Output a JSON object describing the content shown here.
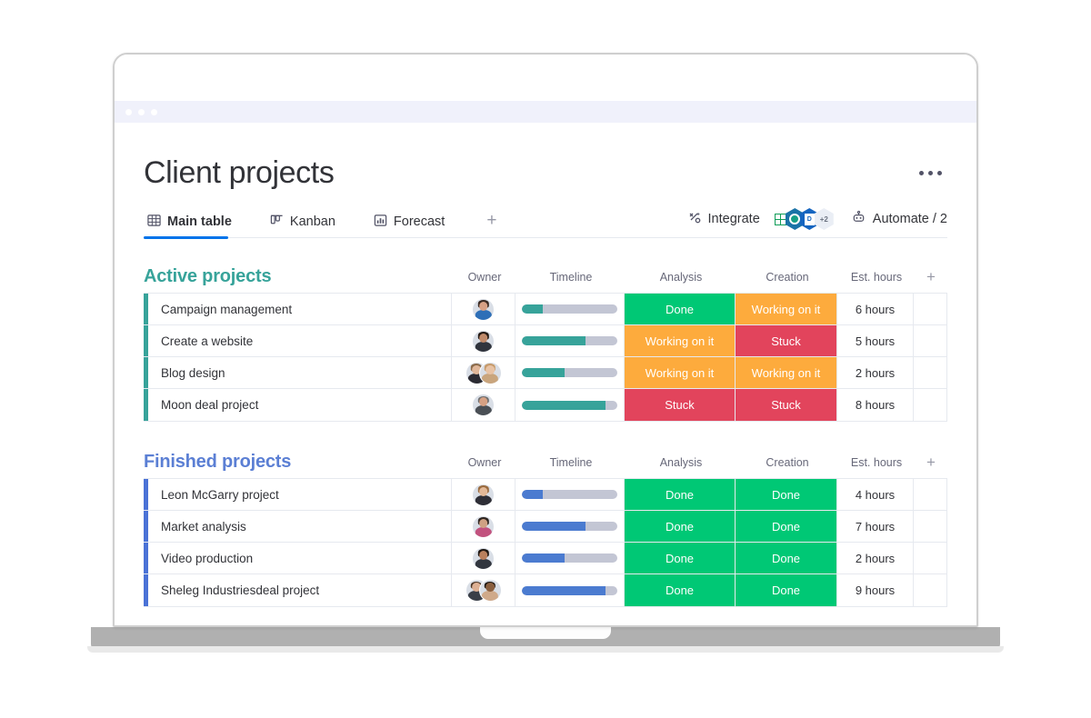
{
  "window": {
    "chrome_dots": 3
  },
  "header": {
    "title": "Client projects",
    "kebab_name": "more-options"
  },
  "tabs": [
    {
      "label": "Main table",
      "icon": "table-grid-icon",
      "active": true
    },
    {
      "label": "Kanban",
      "icon": "kanban-columns-icon",
      "active": false
    },
    {
      "label": "Forecast",
      "icon": "bar-chart-icon",
      "active": false
    }
  ],
  "tabs_add_label": "+",
  "toolbar": {
    "integrate_label": "Integrate",
    "integrate_icon": "integration-plug-icon",
    "automate_label": "Automate / 2",
    "automate_icon": "robot-icon",
    "badges": [
      {
        "name": "google-sheets-badge",
        "overflow": false
      },
      {
        "name": "teal-app-badge",
        "overflow": false
      },
      {
        "name": "document-badge",
        "overflow": false
      },
      {
        "name": "overflow-badge",
        "label": "+2",
        "overflow": true
      }
    ]
  },
  "columns": [
    "Owner",
    "Timeline",
    "Analysis",
    "Creation",
    "Est. hours"
  ],
  "add_column_label": "+",
  "groups": [
    {
      "name": "Active projects",
      "color": "#37a39a",
      "accent": "#37a39a",
      "bar_color": "#37a39a",
      "rows": [
        {
          "name": "Campaign management",
          "owners": [
            {
              "skin": "#d8a185",
              "hair": "#3a2a22",
              "shirt": "#2e6fb7"
            }
          ],
          "progress": 22,
          "analysis": {
            "label": "Done",
            "color": "#00c875"
          },
          "creation": {
            "label": "Working on it",
            "color": "#fdab3d"
          },
          "hours": "6 hours"
        },
        {
          "name": "Create a website",
          "owners": [
            {
              "skin": "#c08a6a",
              "hair": "#241a14",
              "shirt": "#30343d"
            }
          ],
          "progress": 67,
          "analysis": {
            "label": "Working on it",
            "color": "#fdab3d"
          },
          "creation": {
            "label": "Stuck",
            "color": "#e2445c"
          },
          "hours": "5 hours"
        },
        {
          "name": "Blog design",
          "owners": [
            {
              "skin": "#e0b79a",
              "hair": "#8b6b4a",
              "shirt": "#2b2b33"
            },
            {
              "skin": "#e8c3a5",
              "hair": "#c69a6a",
              "shirt": "#c9a57d"
            }
          ],
          "progress": 45,
          "analysis": {
            "label": "Working on it",
            "color": "#fdab3d"
          },
          "creation": {
            "label": "Working on it",
            "color": "#fdab3d"
          },
          "hours": "2 hours"
        },
        {
          "name": "Moon deal project",
          "owners": [
            {
              "skin": "#d6a184",
              "hair": "#6e6e6e",
              "shirt": "#4a4f55"
            }
          ],
          "progress": 88,
          "analysis": {
            "label": "Stuck",
            "color": "#e2445c"
          },
          "creation": {
            "label": "Stuck",
            "color": "#e2445c"
          },
          "hours": "8 hours"
        }
      ]
    },
    {
      "name": "Finished projects",
      "color": "#5b7fd4",
      "accent": "#4a72d6",
      "bar_color": "#4b7bd0",
      "rows": [
        {
          "name": "Leon McGarry project",
          "owners": [
            {
              "skin": "#e3b998",
              "hair": "#9a6b3f",
              "shirt": "#2e2e36"
            }
          ],
          "progress": 22,
          "analysis": {
            "label": "Done",
            "color": "#00c875"
          },
          "creation": {
            "label": "Done",
            "color": "#00c875"
          },
          "hours": "4 hours"
        },
        {
          "name": "Market analysis",
          "owners": [
            {
              "skin": "#cfa183",
              "hair": "#2f2620",
              "shirt": "#c2527e"
            }
          ],
          "progress": 67,
          "analysis": {
            "label": "Done",
            "color": "#00c875"
          },
          "creation": {
            "label": "Done",
            "color": "#00c875"
          },
          "hours": "7 hours"
        },
        {
          "name": "Video production",
          "owners": [
            {
              "skin": "#b9805d",
              "hair": "#1e1712",
              "shirt": "#32363f"
            }
          ],
          "progress": 45,
          "analysis": {
            "label": "Done",
            "color": "#00c875"
          },
          "creation": {
            "label": "Done",
            "color": "#00c875"
          },
          "hours": "2 hours"
        },
        {
          "name": "Sheleg Industriesdeal project",
          "owners": [
            {
              "skin": "#ddb094",
              "hair": "#4a3526",
              "shirt": "#3a3f48"
            },
            {
              "skin": "#8a5f3f",
              "hair": "#1b1510",
              "shirt": "#cfa98a"
            }
          ],
          "progress": 88,
          "analysis": {
            "label": "Done",
            "color": "#00c875"
          },
          "creation": {
            "label": "Done",
            "color": "#00c875"
          },
          "hours": "9 hours"
        }
      ]
    }
  ],
  "colors": {
    "accent_blue": "#0073ea",
    "status_done": "#00c875",
    "status_working": "#fdab3d",
    "status_stuck": "#e2445c",
    "teal": "#37a39a",
    "border": "#e6e9ef"
  }
}
